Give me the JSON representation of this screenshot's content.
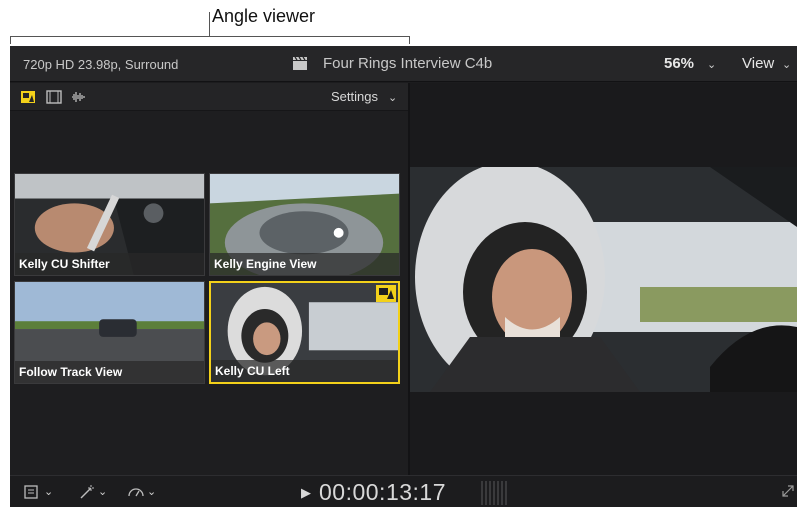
{
  "callout": {
    "label": "Angle viewer"
  },
  "header": {
    "format": "720p HD 23.98p, Surround",
    "project": "Four Rings Interview C4b",
    "zoom": "56%",
    "view_label": "View"
  },
  "angle_viewer": {
    "settings_label": "Settings",
    "angles": [
      {
        "label": "Kelly CU Shifter",
        "active": false
      },
      {
        "label": "Kelly Engine View",
        "active": false
      },
      {
        "label": "Follow Track View",
        "active": false
      },
      {
        "label": "Kelly CU Left",
        "active": true
      }
    ]
  },
  "playback": {
    "timecode": "00:00:13:17"
  },
  "colors": {
    "active_angle": "#f3d11a",
    "background": "#1c1c1e"
  }
}
